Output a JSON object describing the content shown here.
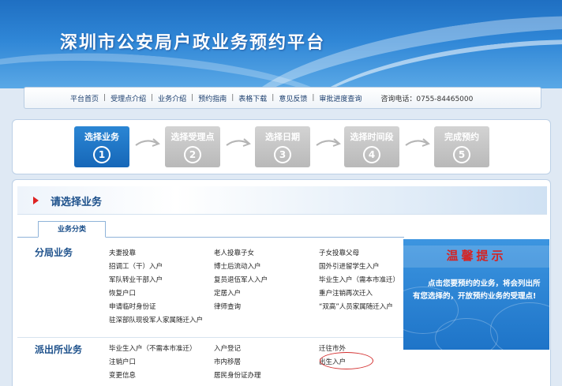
{
  "header": {
    "title": "深圳市公安局户政业务预约平台"
  },
  "nav": {
    "links": [
      "平台首页",
      "受理点介绍",
      "业务介绍",
      "预约指南",
      "表格下载",
      "意见反馈",
      "审批进度查询"
    ],
    "phone": "咨询电话：0755-84465000"
  },
  "steps": [
    {
      "label": "选择业务",
      "num": "1",
      "active": true
    },
    {
      "label": "选择受理点",
      "num": "2",
      "active": false
    },
    {
      "label": "选择日期",
      "num": "3",
      "active": false
    },
    {
      "label": "选择时间段",
      "num": "4",
      "active": false
    },
    {
      "label": "完成预约",
      "num": "5",
      "active": false
    }
  ],
  "section": {
    "title": "请选择业务",
    "tab": "业务分类"
  },
  "groups": [
    {
      "name": "分局业务",
      "items": [
        "夫妻投靠",
        "老人投靠子女",
        "子女投靠父母",
        "招调工（干）入户",
        "博士后流动入户",
        "国外引进留学生入户",
        "军队转业干部入户",
        "复员退伍军人入户",
        "毕业生入户（需本市准迁）",
        "恢复户口",
        "定居入户",
        "重户注销再次迁入",
        "申请临时身份证",
        "律师查询",
        "“双高”人员家属随迁入户",
        "驻深部队现役军人家属随迁入户"
      ]
    },
    {
      "name": "派出所业务",
      "items": [
        "毕业生入户（不需本市准迁）",
        "入户登记",
        "迁往市外",
        "注销户口",
        "市内移居",
        "出生入户",
        "变更信息",
        "居民身份证办理"
      ]
    }
  ],
  "tip": {
    "title": "温馨提示",
    "body": "点击您要预约的业务，将会列出所有您选择的，开放预约业务的受理点!"
  },
  "colors": {
    "accent": "#1667b8",
    "tip_title": "#d52424",
    "heading": "#1b4f8a"
  }
}
